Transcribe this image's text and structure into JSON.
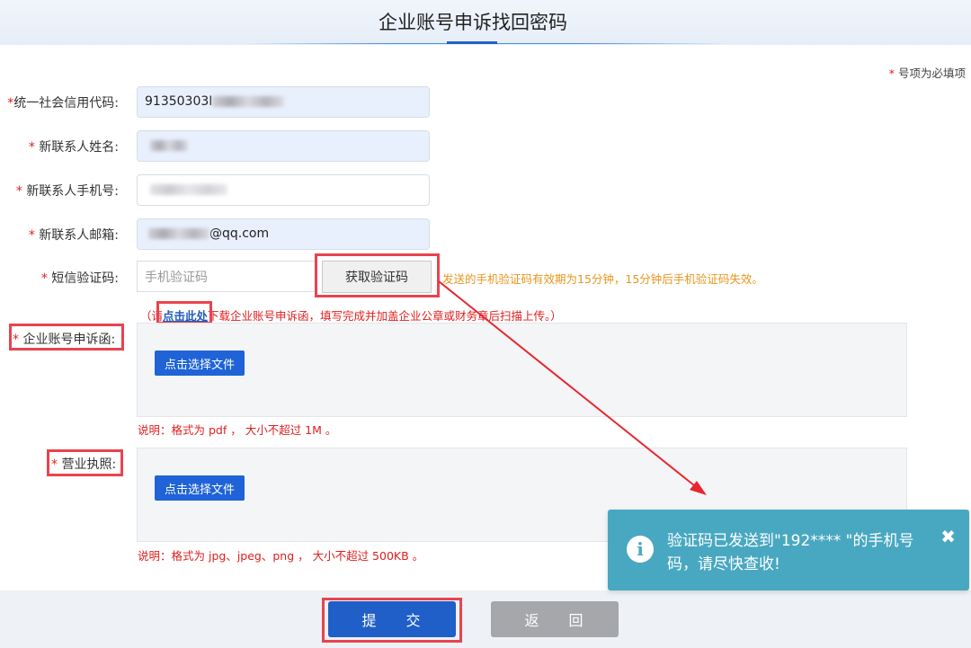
{
  "header": {
    "title": "企业账号申诉找回密码"
  },
  "required_note": "号项为必填项",
  "required_star": "*",
  "fields": {
    "credit_code": {
      "label": "统一社会信用代码:",
      "value_prefix": "91350303I"
    },
    "name": {
      "label": "新联系人姓名:"
    },
    "phone": {
      "label": "新联系人手机号:"
    },
    "email": {
      "label": "新联系人邮箱:",
      "value_suffix": "@qq.com"
    },
    "sms_code": {
      "label": "短信验证码:",
      "placeholder": "手机验证码",
      "button": "获取验证码",
      "hint": "发送的手机验证码有效期为15分钟，15分钟后手机验证码失效。"
    }
  },
  "download_note": {
    "prefix": "（请",
    "link": "点击此处",
    "suffix": "下载企业账号申诉函，填写完成并加盖企业公章或财务章后扫描上传。）"
  },
  "uploads": {
    "letter": {
      "label": "企业账号申诉函:",
      "button": "点击选择文件",
      "note": "说明：格式为 pdf ， 大小不超过 1M 。"
    },
    "license": {
      "label": "营业执照:",
      "button": "点击选择文件",
      "note": "说明：格式为 jpg、jpeg、png ， 大小不超过 500KB 。"
    }
  },
  "buttons": {
    "submit": "提 　 交",
    "back": "返 　 回"
  },
  "toast": {
    "message": "验证码已发送到\"192****      \"的手机号码，请尽快查收!",
    "icon": "info-icon",
    "close": "✖"
  },
  "colors": {
    "primary": "#1f63d6",
    "required": "#e02020",
    "hint": "#e8951d",
    "toast": "#49a8c1",
    "highlight": "#e8434e"
  }
}
